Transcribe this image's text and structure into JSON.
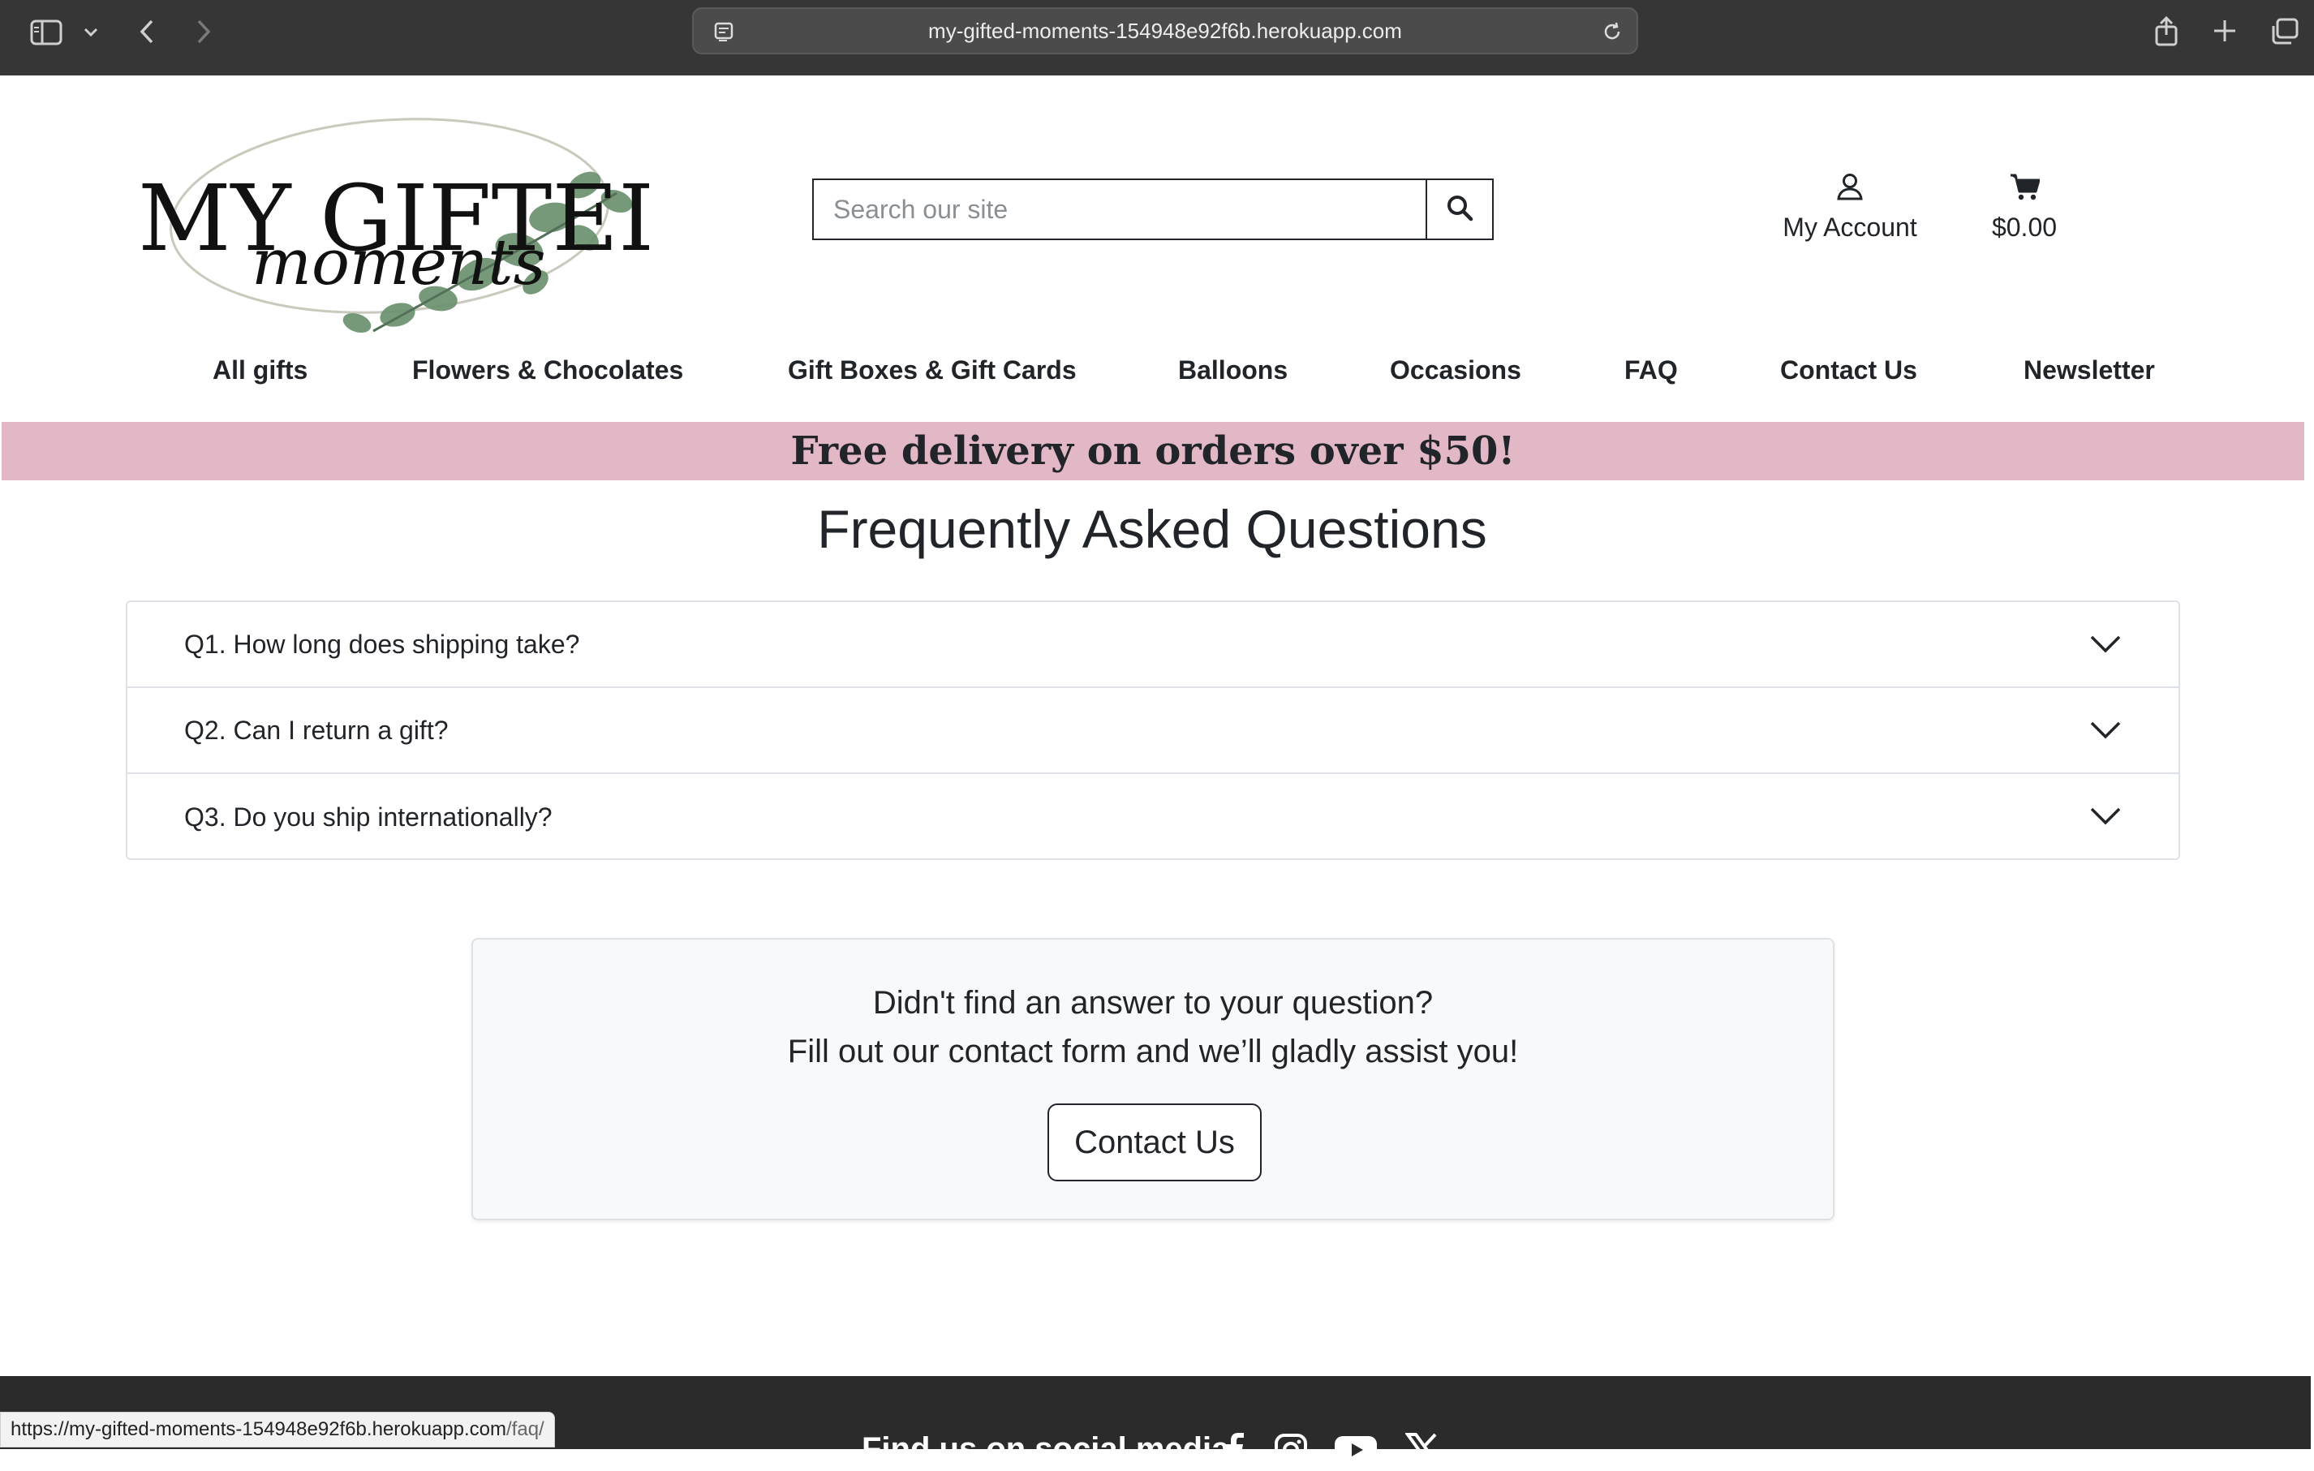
{
  "browser": {
    "url": "my-gifted-moments-154948e92f6b.herokuapp.com"
  },
  "header": {
    "logo_text_top": "MY GIFTED",
    "logo_text_script": "moments",
    "search_placeholder": "Search our site",
    "account_label": "My Account",
    "cart_total": "$0.00"
  },
  "nav": {
    "items": [
      "All gifts",
      "Flowers & Chocolates",
      "Gift Boxes & Gift Cards",
      "Balloons",
      "Occasions",
      "FAQ",
      "Contact Us",
      "Newsletter"
    ]
  },
  "banner": {
    "text": "Free delivery on orders over $50!",
    "color": "#e3b8c6"
  },
  "faq": {
    "title": "Frequently Asked Questions",
    "questions": [
      "Q1. How long does shipping take?",
      "Q2. Can I return a gift?",
      "Q3. Do you ship internationally?"
    ]
  },
  "contact_card": {
    "line1": "Didn't find an answer to your question?",
    "line2": "Fill out our contact form and we’ll gladly assist you!",
    "button": "Contact Us"
  },
  "footer": {
    "social_label": "Find us on social media",
    "icons": [
      "facebook-icon",
      "instagram-icon",
      "youtube-icon",
      "x-icon"
    ]
  },
  "status_bar": {
    "url_base": "https://my-gifted-moments-154948e92f6b.herokuapp.com",
    "url_path": "/faq/"
  }
}
